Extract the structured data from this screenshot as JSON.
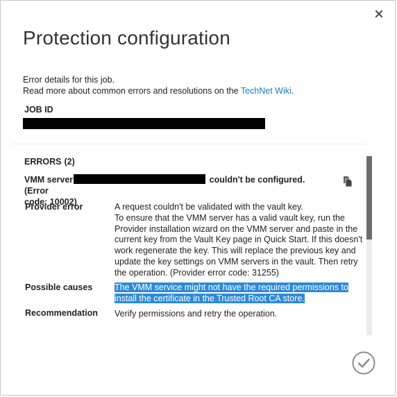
{
  "dialog": {
    "title": "Protection configuration",
    "close_icon": "close-icon",
    "intro": {
      "line1": "Error details for this job.",
      "line2_prefix": "Read more about common errors and resolutions on the ",
      "link_text": "TechNet Wiki",
      "line2_suffix": "."
    },
    "job_id": {
      "label": "JOB ID",
      "value": "[redacted]"
    },
    "errors": {
      "label": "ERRORS",
      "count": "(2)",
      "items": [
        {
          "heading_prefix": "VMM server",
          "heading_redacted": "[redacted]",
          "heading_suffix": "couldn't be configured. (Error",
          "heading_line2": "code: 10002)",
          "copy_icon": "copy-icon",
          "provider_error_label": "Provider error",
          "provider_error_lines": [
            "A request couldn't be validated with the vault key.",
            "To ensure that the VMM server has a valid vault key, run the",
            "Provider installation wizard on the VMM server and paste in the",
            "current key from the Vault Key page in Quick Start. If this doesn't",
            "work regenerate the key. This will replace the previous key and",
            "update the key settings on VMM servers in the vault. Then retry",
            "the operation. (Provider error code: 31255)"
          ],
          "possible_causes_label": "Possible causes",
          "possible_causes_lines": [
            "The VMM service might not have the required permissions to",
            "install the certificate in the Trusted Root CA store."
          ],
          "recommendation_label": "Recommendation",
          "recommendation": "Verify permissions and retry the operation."
        }
      ]
    },
    "ok_icon": "checkmark-icon",
    "colors": {
      "link": "#1a7bbf",
      "selection_highlight": "#2e8ad8",
      "scroll_thumb": "#6d6d6d",
      "scroll_track": "#ececec"
    }
  }
}
